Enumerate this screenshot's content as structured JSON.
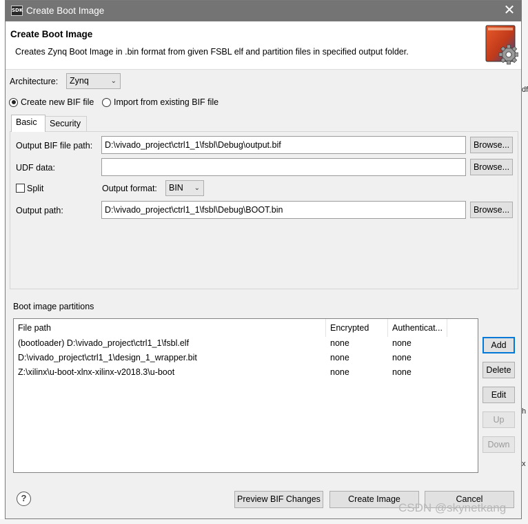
{
  "window": {
    "title": "Create Boot Image",
    "app_icon_label": "SDK"
  },
  "header": {
    "title": "Create Boot Image",
    "description": "Creates Zynq Boot Image in .bin format from given FSBL elf and partition files in specified output folder.",
    "icon": "boot-image-gear-icon"
  },
  "architecture": {
    "label": "Architecture:",
    "value": "Zynq"
  },
  "bif_mode": {
    "create_new_label": "Create new BIF file",
    "import_existing_label": "Import from existing BIF file",
    "selected": "create_new"
  },
  "tabs": [
    {
      "label": "Basic",
      "active": true
    },
    {
      "label": "Security",
      "active": false
    }
  ],
  "basic": {
    "output_bif_label": "Output BIF file path:",
    "output_bif_value": "D:\\vivado_project\\ctrl1_1\\fsbl\\Debug\\output.bif",
    "udf_label": "UDF data:",
    "udf_value": "",
    "split_label": "Split",
    "split_checked": false,
    "output_format_label": "Output format:",
    "output_format_value": "BIN",
    "output_path_label": "Output path:",
    "output_path_value": "D:\\vivado_project\\ctrl1_1\\fsbl\\Debug\\BOOT.bin",
    "browse_label": "Browse..."
  },
  "partitions": {
    "section_label": "Boot image partitions",
    "columns": [
      "File path",
      "Encrypted",
      "Authenticat..."
    ],
    "rows": [
      {
        "file_path": "(bootloader) D:\\vivado_project\\ctrl1_1\\fsbl.elf",
        "encrypted": "none",
        "authenticated": "none"
      },
      {
        "file_path": "D:\\vivado_project\\ctrl1_1\\design_1_wrapper.bit",
        "encrypted": "none",
        "authenticated": "none"
      },
      {
        "file_path": "Z:\\xilinx\\u-boot-xlnx-xilinx-v2018.3\\u-boot",
        "encrypted": "none",
        "authenticated": "none"
      }
    ],
    "buttons": {
      "add": "Add",
      "delete": "Delete",
      "edit": "Edit",
      "up": "Up",
      "down": "Down"
    }
  },
  "footer": {
    "help": "?",
    "preview": "Preview BIF Changes",
    "create": "Create Image",
    "cancel": "Cancel"
  },
  "watermark": "CSDN @skynetkang",
  "background_fragments": [
    "df",
    "h",
    "x"
  ],
  "colors": {
    "titlebar": "#747474",
    "default_button_border": "#0078d7",
    "disabled_text": "#9a9a9a"
  }
}
